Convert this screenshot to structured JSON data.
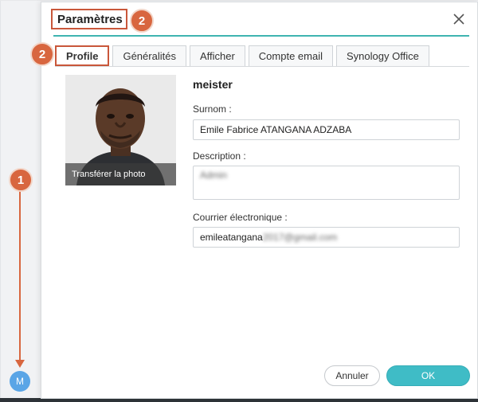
{
  "sidebar": {
    "avatar_initial": "M"
  },
  "dialog": {
    "title": "Paramètres",
    "tabs": [
      {
        "label": "Profile",
        "active": true
      },
      {
        "label": "Généralités",
        "active": false
      },
      {
        "label": "Afficher",
        "active": false
      },
      {
        "label": "Compte email",
        "active": false
      },
      {
        "label": "Synology Office",
        "active": false
      }
    ]
  },
  "profile": {
    "photo_action": "Transférer la photo",
    "username": "meister",
    "nickname_label": "Surnom :",
    "nickname_value": "Emile Fabrice ATANGANA ADZABA",
    "description_label": "Description :",
    "description_value": "Admin",
    "email_label": "Courrier électronique :",
    "email_visible": "emileatangana",
    "email_hidden": "2017@gmail.com"
  },
  "buttons": {
    "cancel": "Annuler",
    "ok": "OK"
  },
  "annotations": {
    "marker_1": "1",
    "marker_2_title": "2",
    "marker_2_tab": "2"
  },
  "colors": {
    "accent": "#3fbcc6",
    "annotation": "#d8663f",
    "title_underline": "#3fb4b0"
  }
}
